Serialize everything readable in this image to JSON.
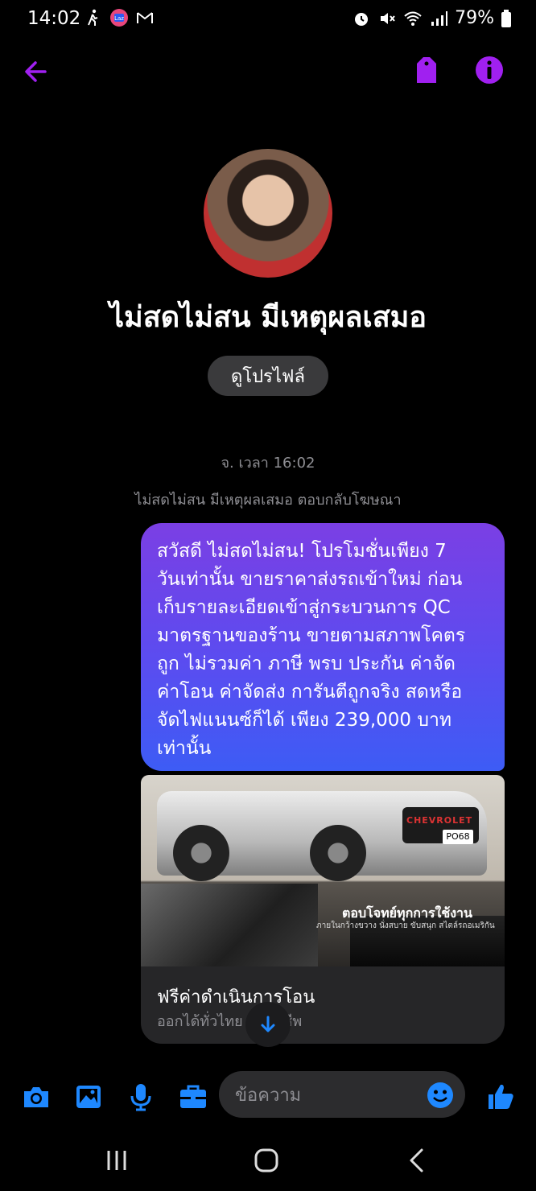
{
  "status_bar": {
    "time": "14:02",
    "battery": "79%"
  },
  "header": {
    "back_icon": "arrow-left-icon",
    "tag_icon": "tag-icon",
    "info_icon": "info-icon",
    "accent": "#a020f0"
  },
  "profile": {
    "name": "ไม่สดไม่สน มีเหตุผลเสมอ",
    "view_profile": "ดูโปรไฟล์"
  },
  "conversation": {
    "timestamp": "จ. เวลา 16:02",
    "reply_note": "ไม่สดไม่สน มีเหตุผลเสมอ ตอบกลับโฆษณา",
    "message_lines": [
      "สวัสดี ไม่สดไม่สน! โปรโมชั่นเพียง 7",
      "วันเท่านั้น ขายราคาส่งรถเข้าใหม่ ก่อน",
      "เก็บรายละเอียดเข้าสู่กระบวนการ QC",
      "มาตรฐานของร้าน ขายตามสภาพโคตร",
      "ถูก ไม่รวมค่า ภาษี พรบ ประกัน ค่าจัด",
      "ค่าโอน ค่าจัดส่ง การันตีถูกจริง สดหรือ",
      "จัดไฟแนนซ์ก็ได้  เพียง 239,000 บาท",
      "เท่านั้น"
    ],
    "card": {
      "brand_text": "CHEVROLET",
      "plate": "PO68",
      "banner": "ตอบโจทย์ทุกการใช้งาน",
      "banner_sub": "ภายในกว้างขวาง นั่งสบาย   ขับสนุก สไตล์รถอเมริกัน",
      "title": "ฟรีค่าดำเนินการโอน",
      "subtitle": "ออกได้ทั่วไทย ทุกอาชีพ"
    }
  },
  "composer": {
    "placeholder": "ข้อความ",
    "icons": [
      "camera-icon",
      "image-icon",
      "microphone-icon",
      "briefcase-icon",
      "emoji-icon",
      "thumbs-up-icon"
    ],
    "accent": "#1e88ff"
  }
}
